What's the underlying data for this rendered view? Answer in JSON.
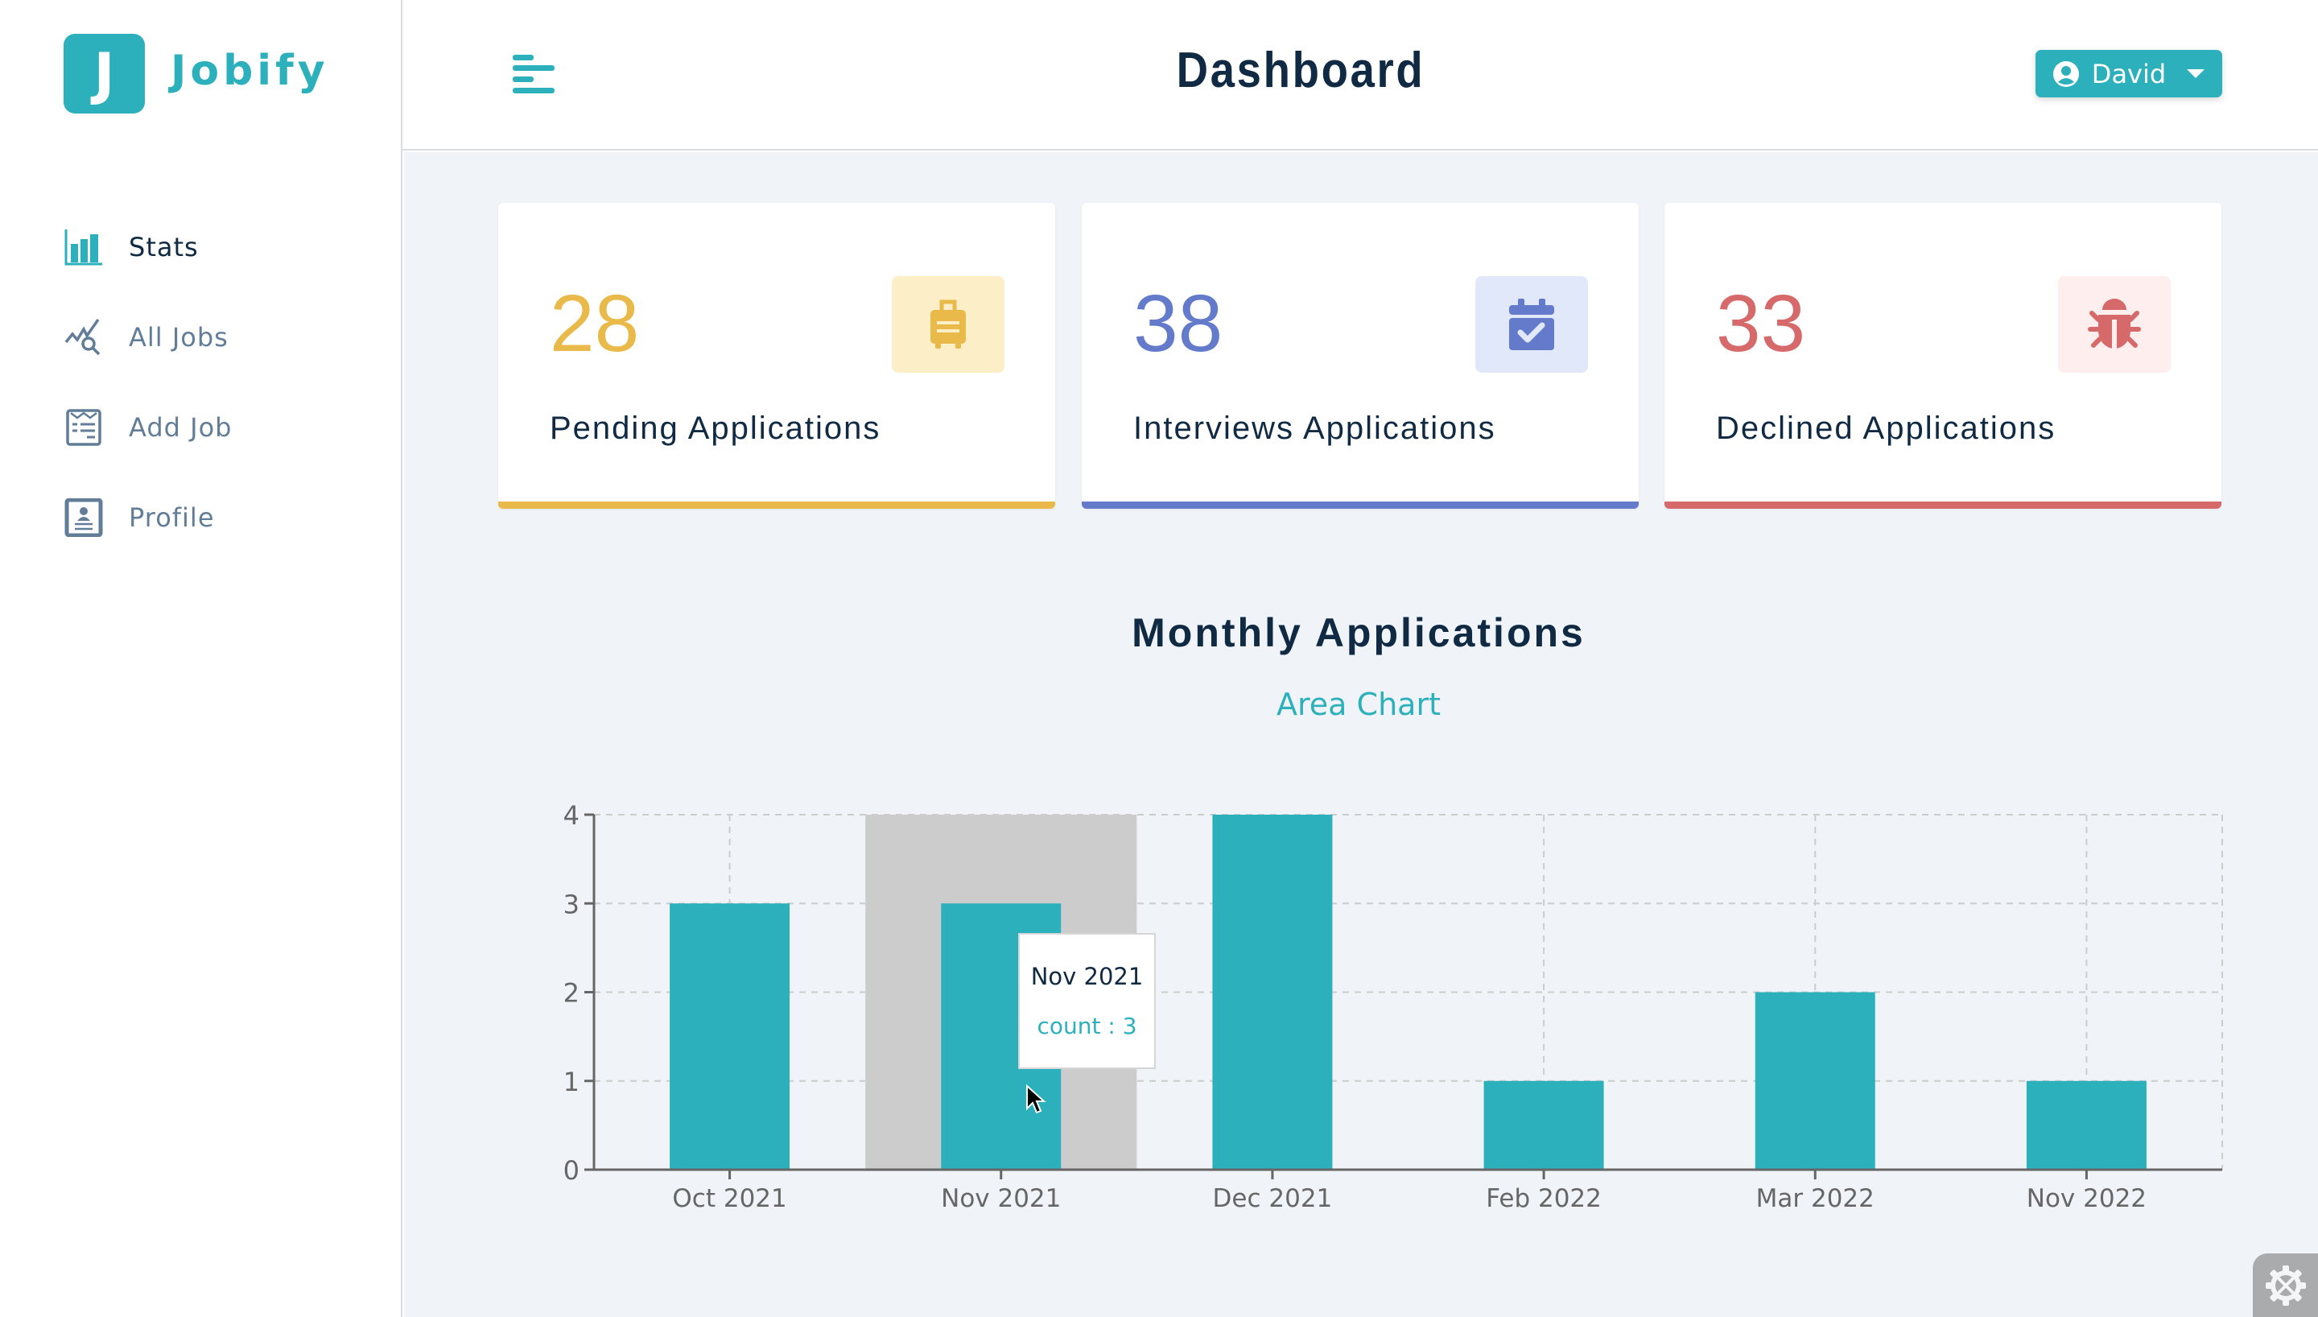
{
  "app": {
    "logo_letter": "J",
    "name": "Jobify"
  },
  "header": {
    "title": "Dashboard",
    "menu_icon": "hamburger-icon",
    "user": {
      "name": "David",
      "icon": "user-circle-icon",
      "dropdown_icon": "caret-down-icon"
    }
  },
  "sidebar": {
    "items": [
      {
        "label": "Stats",
        "icon": "bar-chart-icon",
        "active": true
      },
      {
        "label": "All Jobs",
        "icon": "chart-search-icon",
        "active": false
      },
      {
        "label": "Add Job",
        "icon": "form-icon",
        "active": false
      },
      {
        "label": "Profile",
        "icon": "id-card-icon",
        "active": false
      }
    ]
  },
  "stats": [
    {
      "count": "28",
      "label": "Pending Applications",
      "icon": "suitcase-icon",
      "color": "#e9b949",
      "bg": "#fcefc7"
    },
    {
      "count": "38",
      "label": "Interviews Applications",
      "icon": "calendar-check-icon",
      "color": "#647acb",
      "bg": "#e0e8f9"
    },
    {
      "count": "33",
      "label": "Declined Applications",
      "icon": "bug-icon",
      "color": "#d66a6a",
      "bg": "#ffeeee"
    }
  ],
  "chart_section": {
    "title": "Monthly Applications",
    "toggle_label": "Area Chart"
  },
  "chart_data": {
    "type": "bar",
    "title": "Monthly Applications",
    "xlabel": "",
    "ylabel": "",
    "categories": [
      "Oct 2021",
      "Nov 2021",
      "Dec 2021",
      "Feb 2022",
      "Mar 2022",
      "Nov 2022"
    ],
    "series": [
      {
        "name": "count",
        "values": [
          3,
          3,
          4,
          1,
          2,
          1
        ],
        "color": "#2cb1bc"
      }
    ],
    "ylim": [
      0,
      4
    ],
    "yticks": [
      0,
      1,
      2,
      3,
      4
    ],
    "grid": true,
    "highlighted_category": "Nov 2021",
    "tooltip": {
      "label": "Nov 2021",
      "value_text": "count : 3"
    }
  },
  "settings_icon": "gear-wrench-icon"
}
